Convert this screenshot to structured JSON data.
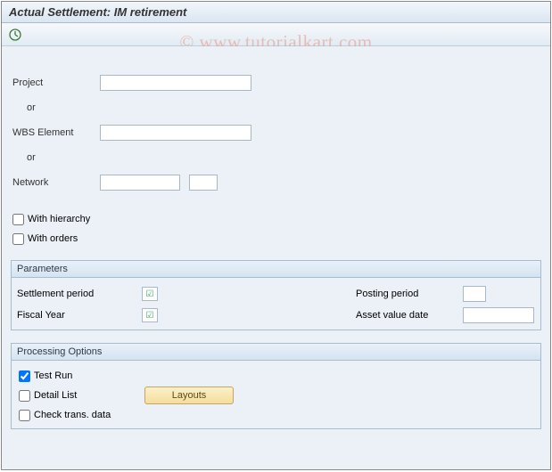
{
  "header": {
    "title": "Actual Settlement: IM retirement"
  },
  "watermark": "© www.tutorialkart.com",
  "selection": {
    "project_label": "Project",
    "or_label": "or",
    "wbs_label": "WBS Element",
    "network_label": "Network",
    "project_value": "",
    "wbs_value": "",
    "network_value": "",
    "network_value2": ""
  },
  "options": {
    "with_hierarchy_label": "With hierarchy",
    "with_hierarchy_checked": false,
    "with_orders_label": "With orders",
    "with_orders_checked": false
  },
  "parameters": {
    "group_title": "Parameters",
    "settlement_period_label": "Settlement period",
    "settlement_period_required": true,
    "fiscal_year_label": "Fiscal Year",
    "fiscal_year_required": true,
    "posting_period_label": "Posting period",
    "posting_period_value": "",
    "asset_value_date_label": "Asset value date",
    "asset_value_date_value": ""
  },
  "processing": {
    "group_title": "Processing Options",
    "test_run_label": "Test Run",
    "test_run_checked": true,
    "detail_list_label": "Detail List",
    "detail_list_checked": false,
    "layouts_button": "Layouts",
    "check_trans_label": "Check trans. data",
    "check_trans_checked": false
  }
}
